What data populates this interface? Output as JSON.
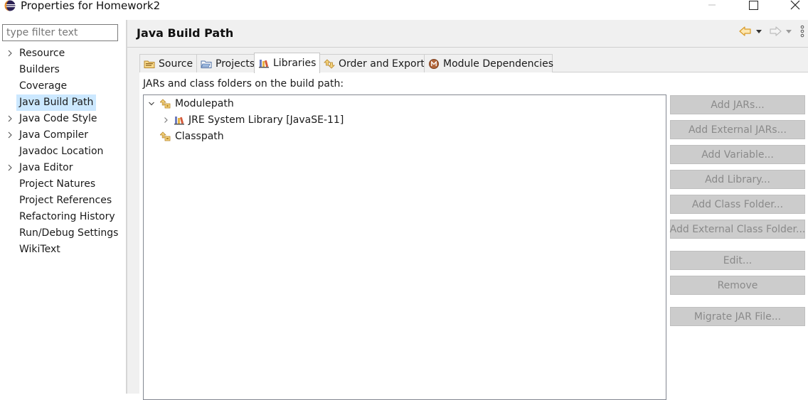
{
  "window": {
    "title": "Properties for Homework2"
  },
  "filter": {
    "placeholder": "type filter text"
  },
  "nav": {
    "items": [
      {
        "label": "Resource",
        "expandable": true,
        "selected": false
      },
      {
        "label": "Builders",
        "expandable": false,
        "selected": false
      },
      {
        "label": "Coverage",
        "expandable": false,
        "selected": false
      },
      {
        "label": "Java Build Path",
        "expandable": false,
        "selected": true
      },
      {
        "label": "Java Code Style",
        "expandable": true,
        "selected": false
      },
      {
        "label": "Java Compiler",
        "expandable": true,
        "selected": false
      },
      {
        "label": "Javadoc Location",
        "expandable": false,
        "selected": false
      },
      {
        "label": "Java Editor",
        "expandable": true,
        "selected": false
      },
      {
        "label": "Project Natures",
        "expandable": false,
        "selected": false
      },
      {
        "label": "Project References",
        "expandable": false,
        "selected": false
      },
      {
        "label": "Refactoring History",
        "expandable": false,
        "selected": false
      },
      {
        "label": "Run/Debug Settings",
        "expandable": false,
        "selected": false
      },
      {
        "label": "WikiText",
        "expandable": false,
        "selected": false
      }
    ]
  },
  "page": {
    "title": "Java Build Path"
  },
  "tabs": [
    {
      "label": "Source",
      "icon": "source-folder-icon",
      "active": false
    },
    {
      "label": "Projects",
      "icon": "projects-icon",
      "active": false
    },
    {
      "label": "Libraries",
      "icon": "libraries-icon",
      "active": true
    },
    {
      "label": "Order and Export",
      "icon": "order-export-icon",
      "active": false
    },
    {
      "label": "Module Dependencies",
      "icon": "module-dependencies-icon",
      "active": false
    }
  ],
  "libraries": {
    "section_label": "JARs and class folders on the build path:",
    "tree": {
      "modulepath": {
        "label": "Modulepath",
        "expanded": true,
        "icon": "modulepath-icon"
      },
      "jre": {
        "label": "JRE System Library [JavaSE-11]",
        "expanded": false,
        "icon": "library-icon"
      },
      "classpath": {
        "label": "Classpath",
        "icon": "classpath-icon"
      }
    }
  },
  "buttons": {
    "add_jars": "Add JARs...",
    "add_external_jars": "Add External JARs...",
    "add_variable": "Add Variable...",
    "add_library": "Add Library...",
    "add_class_folder": "Add Class Folder...",
    "add_external_class_folder": "Add External Class Folder...",
    "edit": "Edit...",
    "remove": "Remove",
    "migrate_jar": "Migrate JAR File..."
  },
  "colors": {
    "selection": "#cce8ff",
    "pane_bg": "#f0f0f0",
    "button_bg": "#cccccc",
    "button_text_disabled": "#8a8a8a",
    "nav_arrow": "#e8a33c"
  }
}
